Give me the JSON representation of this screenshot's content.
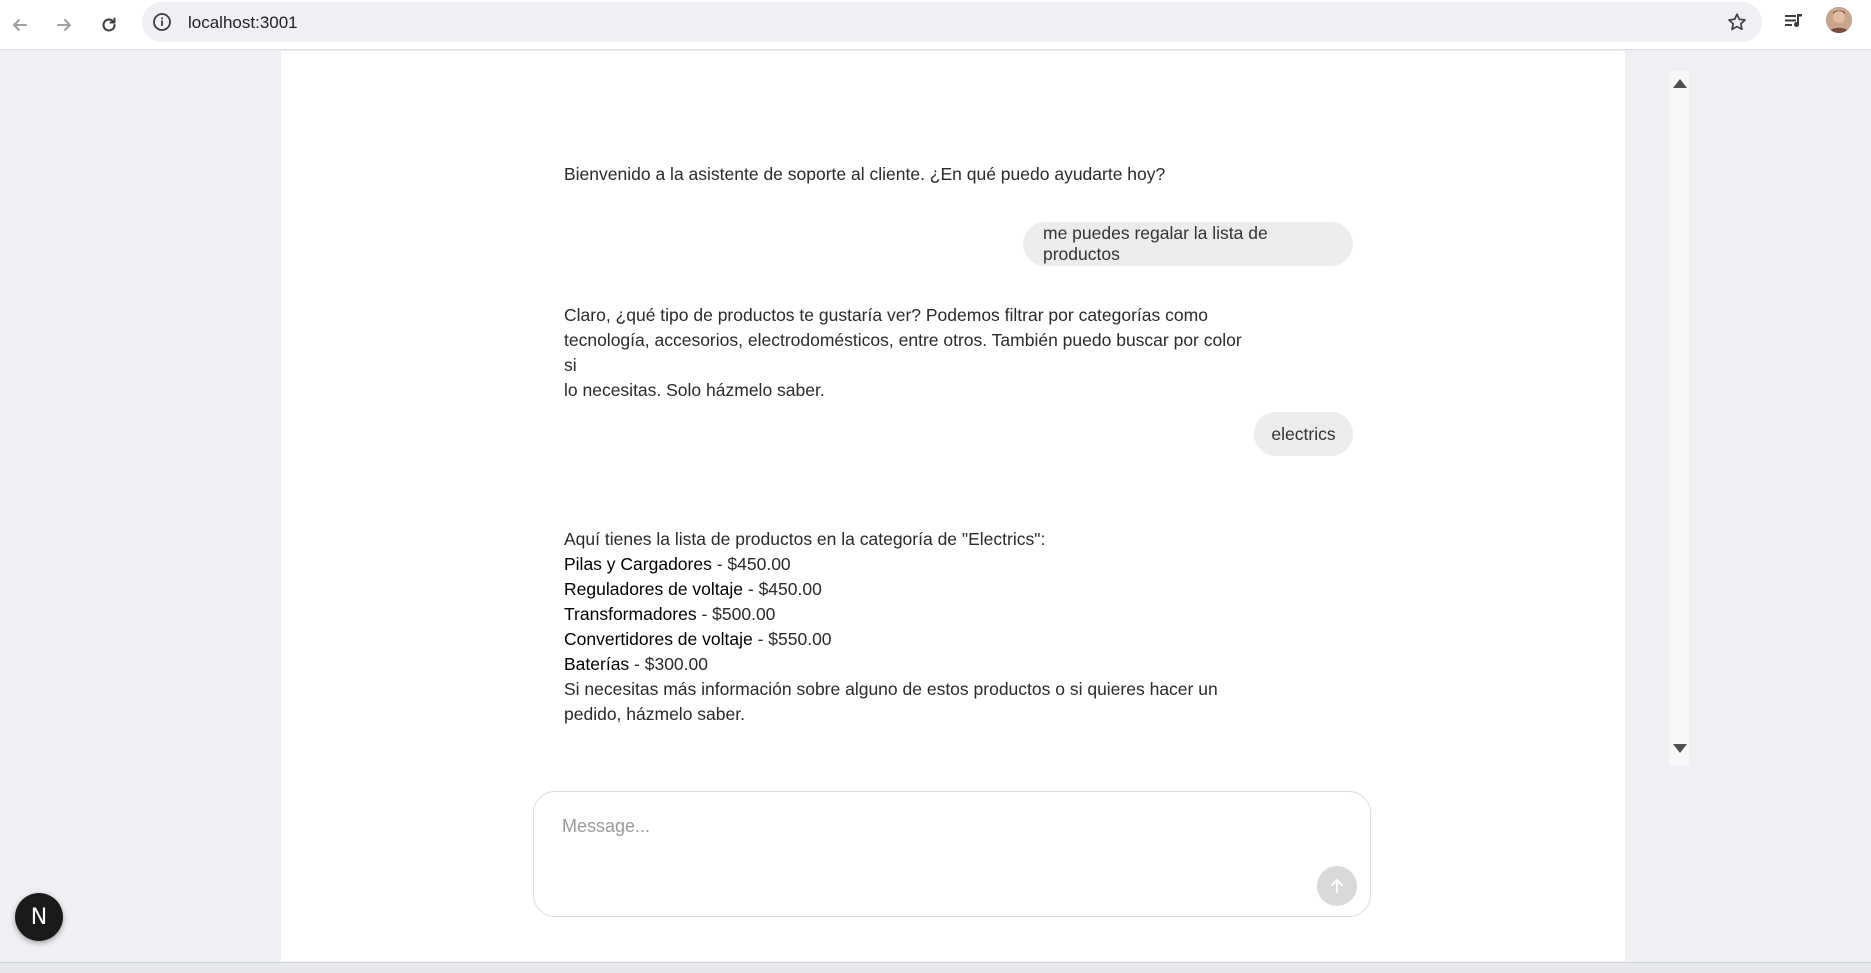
{
  "browser": {
    "url": "localhost:3001",
    "icons": {
      "back": "arrow-left-icon",
      "forward": "arrow-right-icon",
      "reload": "reload-icon",
      "site_info": "info-icon",
      "bookmark": "star-icon",
      "media": "media-control-icon",
      "profile": "avatar"
    }
  },
  "chat": {
    "messages": [
      {
        "role": "assistant",
        "lines": [
          "Bienvenido a la asistente de soporte al cliente. ¿En qué puedo ayudarte hoy?"
        ]
      },
      {
        "role": "user",
        "text": "me puedes regalar la lista de productos"
      },
      {
        "role": "assistant",
        "lines": [
          "Claro, ¿qué tipo de productos te gustaría ver? Podemos filtrar por categorías como",
          "tecnología, accesorios, electrodomésticos, entre otros. También puedo buscar por color si",
          "lo necesitas. Solo házmelo saber."
        ]
      },
      {
        "role": "user",
        "text": "electrics"
      },
      {
        "role": "assistant",
        "intro": "Aquí tienes la lista de productos en la categoría de \"Electrics\":",
        "products": [
          {
            "name": "Pilas y Cargadores",
            "price": " - $450.00"
          },
          {
            "name": "Reguladores de voltaje",
            "price": " - $450.00"
          },
          {
            "name": "Transformadores",
            "price": " - $500.00"
          },
          {
            "name": "Convertidores de voltaje",
            "price": " - $550.00"
          },
          {
            "name": "Baterías",
            "price": " - $300.00"
          }
        ],
        "outro": [
          "Si necesitas más información sobre alguno de estos productos o si quieres hacer un",
          "pedido, házmelo saber."
        ]
      }
    ]
  },
  "composer": {
    "placeholder": "Message...",
    "value": "",
    "send_icon": "arrow-up-icon"
  },
  "dev_badge": {
    "label": "N"
  },
  "colors": {
    "page_bg": "#eef0f4",
    "panel_bg": "#ffffff",
    "user_bubble": "#ececec",
    "send_button": "#d9d9d9"
  }
}
